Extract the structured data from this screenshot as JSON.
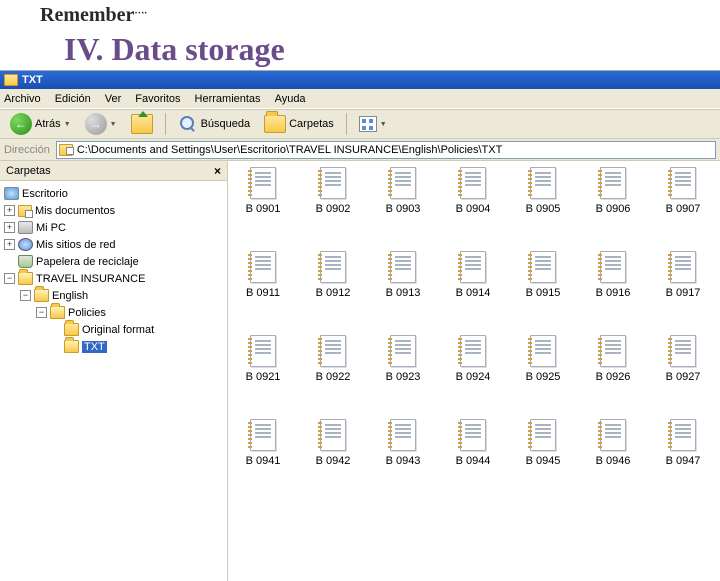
{
  "slide": {
    "remember": "Remember",
    "dots": "….",
    "title": "IV. Data storage"
  },
  "window": {
    "title": "TXT"
  },
  "menubar": [
    "Archivo",
    "Edición",
    "Ver",
    "Favoritos",
    "Herramientas",
    "Ayuda"
  ],
  "toolbar": {
    "back": "Atrás",
    "search": "Búsqueda",
    "folders": "Carpetas"
  },
  "addressbar": {
    "label": "Dirección",
    "path": "C:\\Documents and Settings\\User\\Escritorio\\TRAVEL INSURANCE\\English\\Policies\\TXT"
  },
  "folders_panel": {
    "header": "Carpetas"
  },
  "tree": {
    "desktop": "Escritorio",
    "mydocs": "Mis documentos",
    "mypc": "Mi PC",
    "network": "Mis sitios de red",
    "recycle": "Papelera de reciclaje",
    "travel": "TRAVEL INSURANCE",
    "english": "English",
    "policies": "Policies",
    "original": "Original format",
    "txt": "TXT"
  },
  "files": [
    [
      "B 0901",
      "B 0902",
      "B 0903",
      "B 0904",
      "B 0905",
      "B 0906",
      "B 0907"
    ],
    [
      "B 0911",
      "B 0912",
      "B 0913",
      "B 0914",
      "B 0915",
      "B 0916",
      "B 0917"
    ],
    [
      "B 0921",
      "B 0922",
      "B 0923",
      "B 0924",
      "B 0925",
      "B 0926",
      "B 0927"
    ],
    [
      "B 0941",
      "B 0942",
      "B 0943",
      "B 0944",
      "B 0945",
      "B 0946",
      "B 0947"
    ]
  ]
}
